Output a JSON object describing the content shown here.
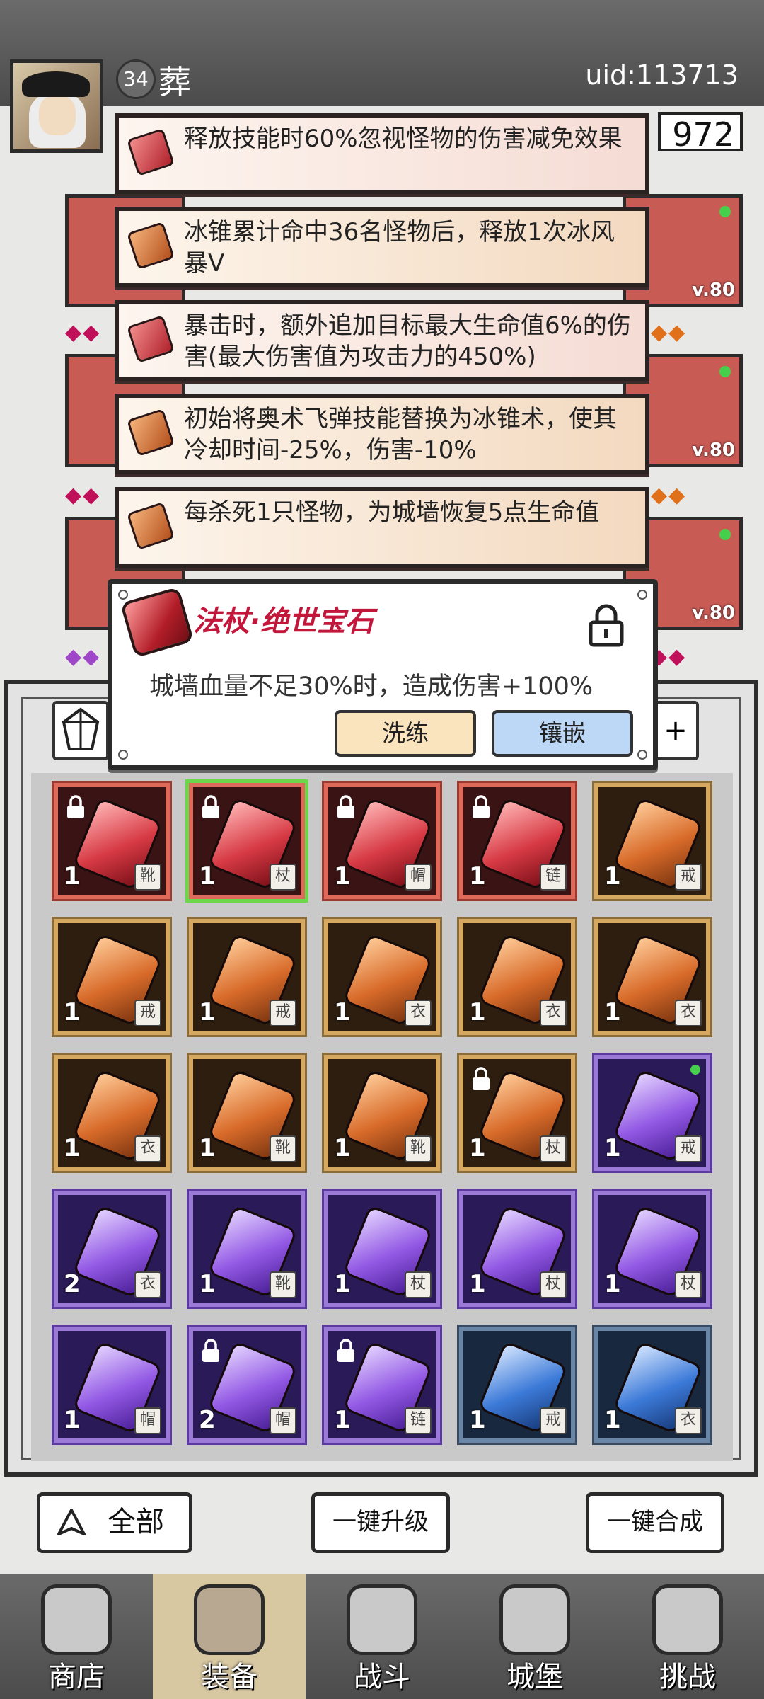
{
  "player": {
    "level": "34",
    "name": "葬",
    "uid": "uid:113713",
    "currency": "972"
  },
  "equipment_slots": {
    "level_label": "v.80"
  },
  "affixes": [
    {
      "color": "red",
      "text": "释放技能时60%忽视怪物的伤害减免效果"
    },
    {
      "color": "orange",
      "text": "冰锥累计命中36名怪物后，释放1次冰风暴V"
    },
    {
      "color": "red",
      "text": "暴击时，额外追加目标最大生命值6%的伤害(最大伤害值为攻击力的450%)"
    },
    {
      "color": "orange",
      "text": "初始将奥术飞弹技能替换为冰锥术，使其冷却时间-25%，伤害-10%"
    },
    {
      "color": "orange",
      "text": "每杀死1只怪物，为城墙恢复5点生命值"
    }
  ],
  "popup": {
    "title": "法杖·绝世宝石",
    "description": "城墙血量不足30%时，造成伤害+100%",
    "reroll_label": "洗练",
    "inlay_label": "镶嵌"
  },
  "filter": {
    "plus_label": "+"
  },
  "inventory": [
    {
      "rarity": "red",
      "count": "1",
      "slot": "靴",
      "locked": true
    },
    {
      "rarity": "red",
      "count": "1",
      "slot": "杖",
      "locked": true,
      "selected": true
    },
    {
      "rarity": "red",
      "count": "1",
      "slot": "帽",
      "locked": true
    },
    {
      "rarity": "red",
      "count": "1",
      "slot": "链",
      "locked": true
    },
    {
      "rarity": "orange",
      "count": "1",
      "slot": "戒"
    },
    {
      "rarity": "orange",
      "count": "1",
      "slot": "戒"
    },
    {
      "rarity": "orange",
      "count": "1",
      "slot": "戒"
    },
    {
      "rarity": "orange",
      "count": "1",
      "slot": "衣"
    },
    {
      "rarity": "orange",
      "count": "1",
      "slot": "衣"
    },
    {
      "rarity": "orange",
      "count": "1",
      "slot": "衣"
    },
    {
      "rarity": "orange",
      "count": "1",
      "slot": "衣"
    },
    {
      "rarity": "orange",
      "count": "1",
      "slot": "靴"
    },
    {
      "rarity": "orange",
      "count": "1",
      "slot": "靴"
    },
    {
      "rarity": "orange",
      "count": "1",
      "slot": "杖",
      "locked": true
    },
    {
      "rarity": "purple",
      "count": "1",
      "slot": "戒",
      "new": true
    },
    {
      "rarity": "purple",
      "count": "2",
      "slot": "衣"
    },
    {
      "rarity": "purple",
      "count": "1",
      "slot": "靴"
    },
    {
      "rarity": "purple",
      "count": "1",
      "slot": "杖"
    },
    {
      "rarity": "purple",
      "count": "1",
      "slot": "杖"
    },
    {
      "rarity": "purple",
      "count": "1",
      "slot": "杖"
    },
    {
      "rarity": "purple",
      "count": "1",
      "slot": "帽"
    },
    {
      "rarity": "purple",
      "count": "2",
      "slot": "帽",
      "locked": true
    },
    {
      "rarity": "purple",
      "count": "1",
      "slot": "链",
      "locked": true
    },
    {
      "rarity": "blue",
      "count": "1",
      "slot": "戒"
    },
    {
      "rarity": "blue",
      "count": "1",
      "slot": "衣"
    }
  ],
  "actions": {
    "all_label": "全部",
    "upgrade_label": "一键升级",
    "merge_label": "一键合成"
  },
  "nav": [
    {
      "label": "商店",
      "icon": "shop-icon"
    },
    {
      "label": "装备",
      "icon": "backpack-icon"
    },
    {
      "label": "战斗",
      "icon": "crossed-swords-icon"
    },
    {
      "label": "城堡",
      "icon": "castle-icon"
    },
    {
      "label": "挑战",
      "icon": "shield-icon"
    }
  ],
  "colors": {
    "red_tier": "#e06a5a",
    "orange_tier": "#d7a860",
    "purple_tier": "#9a7ad6",
    "blue_tier": "#6a86a6",
    "popup_title": "#c2163a"
  }
}
